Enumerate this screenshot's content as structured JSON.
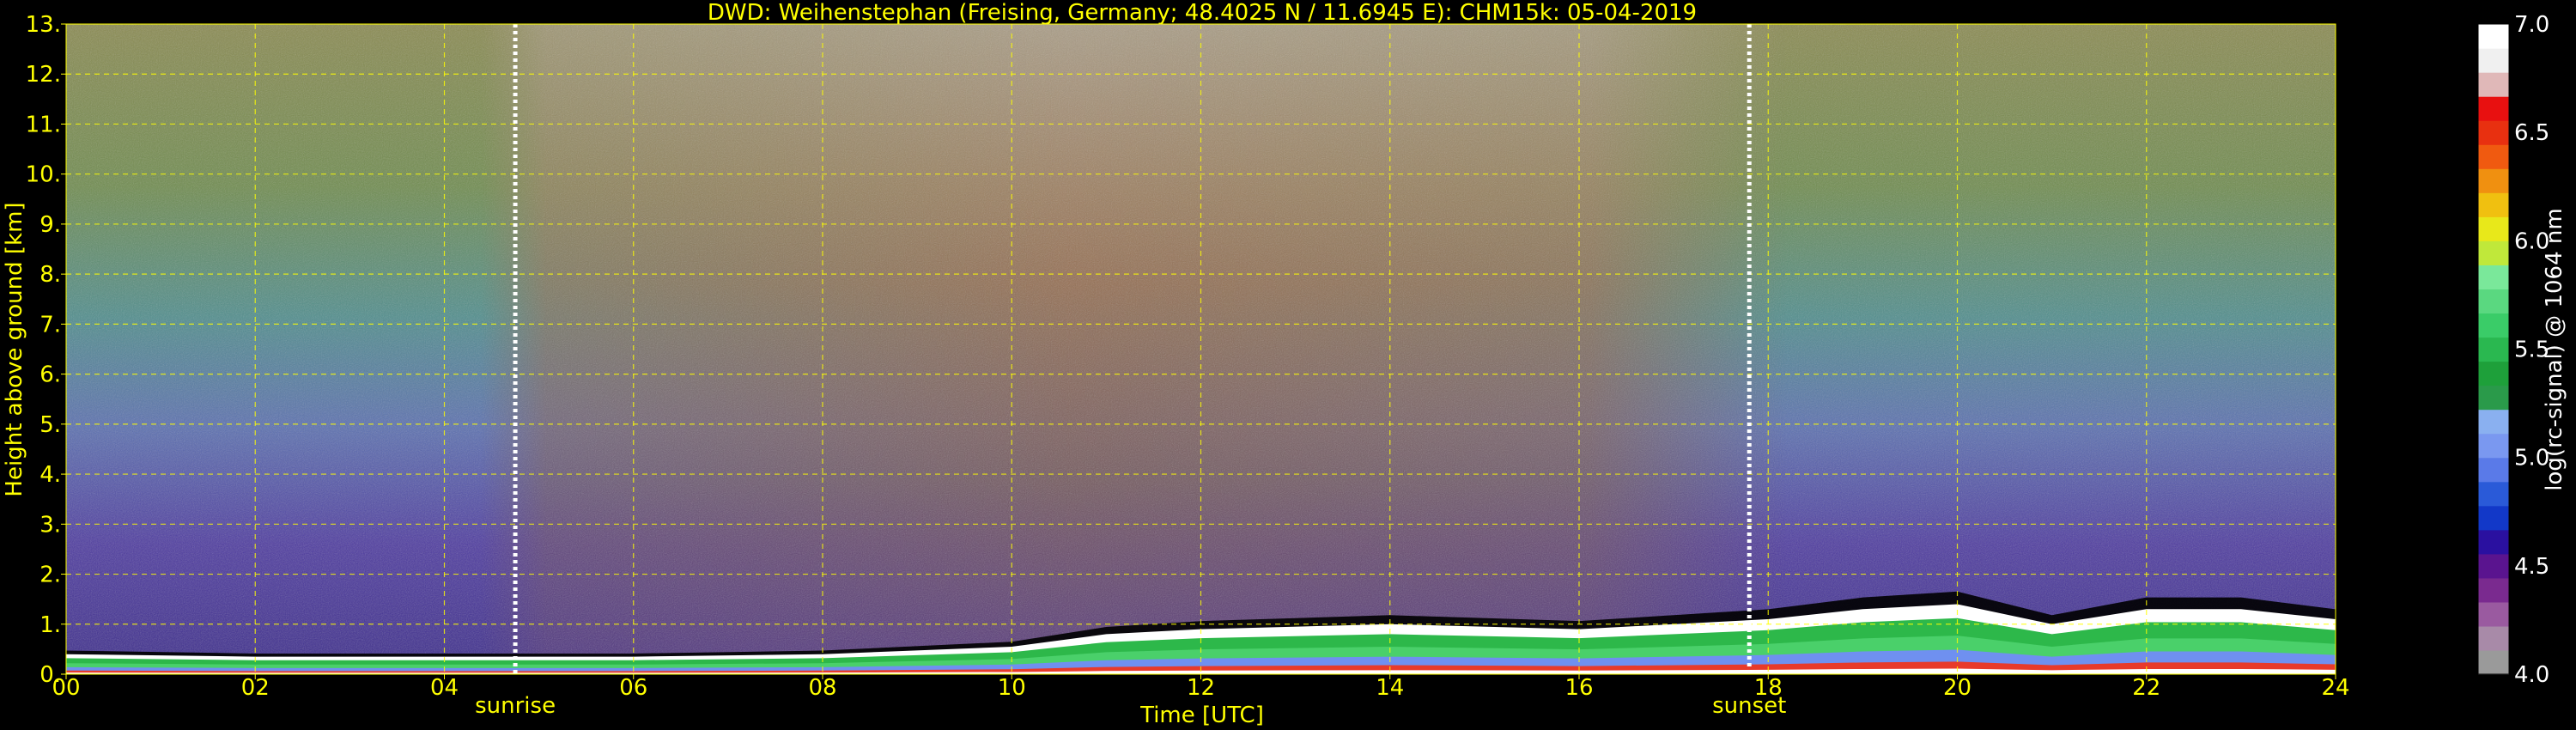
{
  "chart_data": {
    "type": "heatmap",
    "title": "DWD: Weihenstephan (Freising, Germany; 48.4025 N / 11.6945 E):    CHM15k: 05-04-2019",
    "xlabel": "Time [UTC]",
    "ylabel": "Height above ground [km]",
    "colorbar_label": "log(rc-signal) @ 1064 nm",
    "xlim": [
      0,
      24
    ],
    "ylim": [
      0,
      13
    ],
    "clim": [
      4.0,
      7.0
    ],
    "x_ticks": [
      "00",
      "02",
      "04",
      "06",
      "08",
      "10",
      "12",
      "14",
      "16",
      "18",
      "20",
      "22",
      "24"
    ],
    "y_ticks": [
      "0.",
      "1.",
      "2.",
      "3.",
      "4.",
      "5.",
      "6.",
      "7.",
      "8.",
      "9.",
      "10.",
      "11.",
      "12.",
      "13."
    ],
    "colorbar_ticks": [
      "4.0",
      "4.5",
      "5.0",
      "5.5",
      "6.0",
      "6.5",
      "7.0"
    ],
    "grid": true,
    "markers": [
      {
        "label": "sunrise",
        "x": 4.75
      },
      {
        "label": "sunset",
        "x": 17.8
      }
    ],
    "boundary_layer_top_km": [
      [
        0,
        0.4
      ],
      [
        2,
        0.35
      ],
      [
        4,
        0.35
      ],
      [
        6,
        0.35
      ],
      [
        8,
        0.4
      ],
      [
        10,
        0.55
      ],
      [
        11,
        0.8
      ],
      [
        12,
        0.9
      ],
      [
        14,
        1.0
      ],
      [
        16,
        0.9
      ],
      [
        18,
        1.1
      ],
      [
        19,
        1.3
      ],
      [
        20,
        1.4
      ],
      [
        21,
        1.0
      ],
      [
        22,
        1.3
      ],
      [
        23,
        1.3
      ],
      [
        24,
        1.1
      ]
    ],
    "colors": {
      "text": "#ffff00",
      "grid": "#ffff00",
      "background": "#000000"
    }
  }
}
